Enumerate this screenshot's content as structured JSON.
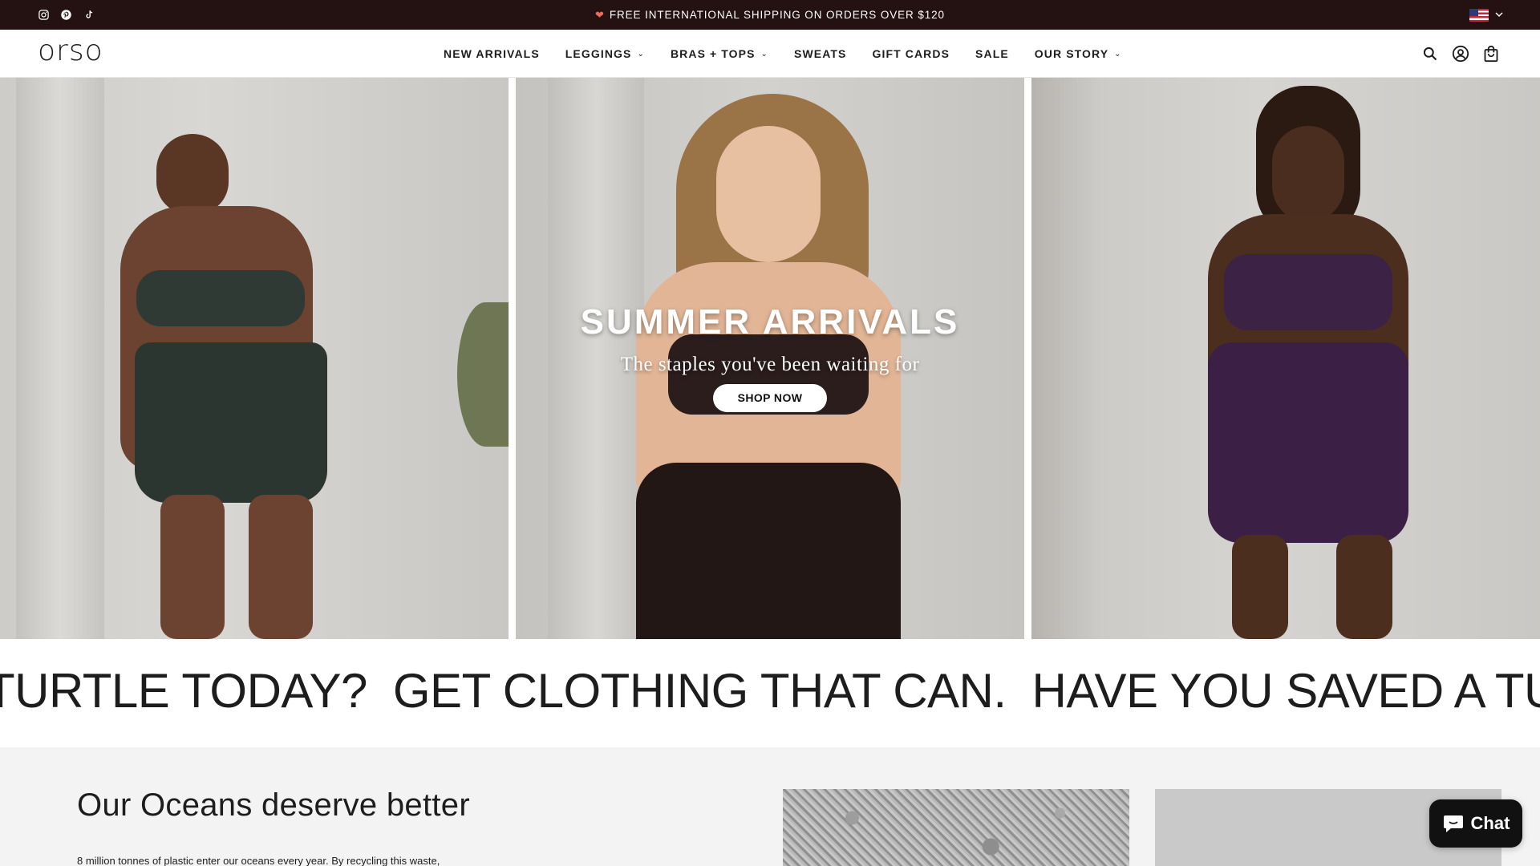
{
  "announcement": {
    "message": "FREE INTERNATIONAL SHIPPING ON ORDERS OVER $120",
    "socials": [
      "instagram-icon",
      "pinterest-icon",
      "tiktok-icon"
    ],
    "country_flag": "us-flag-icon"
  },
  "header": {
    "logo": "orso",
    "nav": [
      {
        "label": "NEW ARRIVALS",
        "dropdown": false
      },
      {
        "label": "LEGGINGS",
        "dropdown": true
      },
      {
        "label": "BRAS + TOPS",
        "dropdown": true
      },
      {
        "label": "SWEATS",
        "dropdown": false
      },
      {
        "label": "GIFT CARDS",
        "dropdown": false
      },
      {
        "label": "SALE",
        "dropdown": false
      },
      {
        "label": "OUR STORY",
        "dropdown": true
      }
    ],
    "icons": [
      "search-icon",
      "account-icon",
      "cart-icon"
    ]
  },
  "hero": {
    "title": "SUMMER ARRIVALS",
    "subtitle": "The staples you've been waiting for",
    "cta": "SHOP NOW"
  },
  "marquee": {
    "items": [
      "TURTLE TODAY?",
      "GET CLOTHING THAT CAN.",
      "HAVE YOU SAVED A TURT"
    ]
  },
  "oceans": {
    "title": "Our Oceans deserve better",
    "body": "8 million tonnes of plastic enter our oceans every year. By recycling this waste,"
  },
  "chat": {
    "label": "Chat"
  },
  "colors": {
    "announcement_bg": "#241212",
    "text": "#1d1d1d",
    "section_bg": "#f3f3f3",
    "chat_bg": "#111111"
  }
}
